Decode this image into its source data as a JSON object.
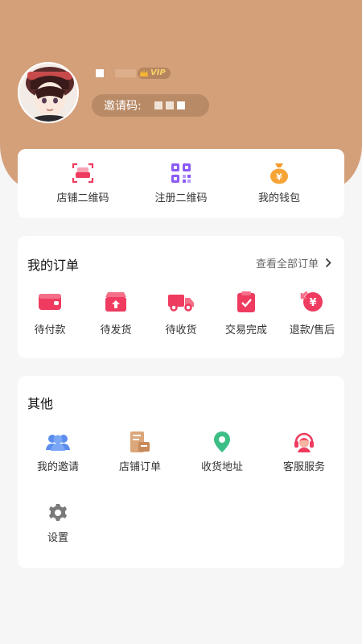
{
  "profile": {
    "vip_label": "VIP",
    "invite_label": "邀请码:"
  },
  "quick_actions": [
    {
      "label": "店铺二维码",
      "icon": "store-qr-icon"
    },
    {
      "label": "注册二维码",
      "icon": "qr-code-icon"
    },
    {
      "label": "我的钱包",
      "icon": "money-bag-icon"
    }
  ],
  "orders": {
    "title": "我的订单",
    "view_all": "查看全部订单",
    "items": [
      {
        "label": "待付款",
        "icon": "wallet-icon"
      },
      {
        "label": "待发货",
        "icon": "ship-box-icon"
      },
      {
        "label": "待收货",
        "icon": "truck-icon"
      },
      {
        "label": "交易完成",
        "icon": "clipboard-check-icon"
      },
      {
        "label": "退款/售后",
        "icon": "refund-icon"
      }
    ]
  },
  "other": {
    "title": "其他",
    "items": [
      {
        "label": "我的邀请",
        "icon": "users-icon"
      },
      {
        "label": "店铺订单",
        "icon": "store-order-icon"
      },
      {
        "label": "收货地址",
        "icon": "location-pin-icon"
      },
      {
        "label": "客服服务",
        "icon": "customer-service-icon"
      },
      {
        "label": "设置",
        "icon": "gear-icon"
      }
    ]
  },
  "colors": {
    "header": "#d4a07a",
    "accent_red": "#ee3b5f",
    "purple": "#8a5cf6",
    "orange": "#f79b2e",
    "green": "#3cbf86",
    "blue": "#5b8def",
    "gray": "#7a7a7a"
  }
}
